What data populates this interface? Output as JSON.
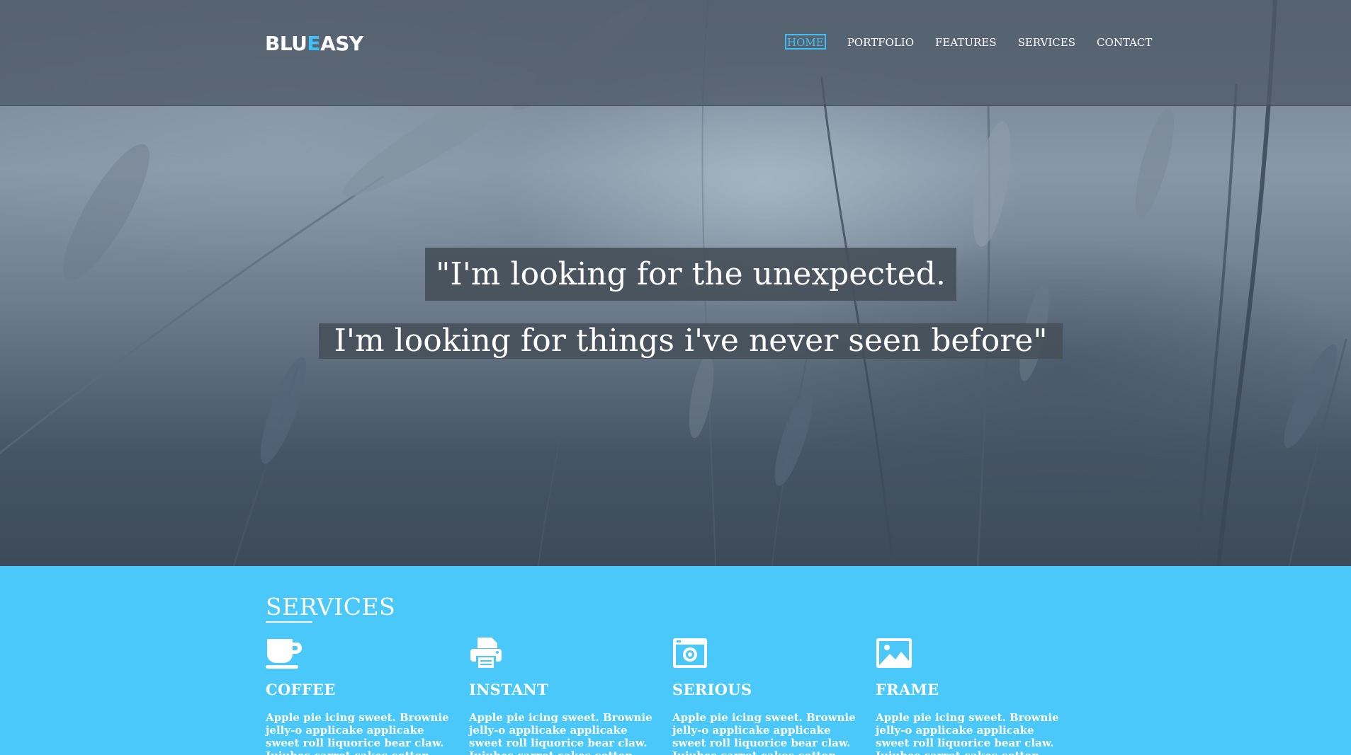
{
  "brand": {
    "logo_part1": "BLU",
    "logo_accent": "E",
    "logo_part2": "ASY"
  },
  "nav": {
    "items": [
      {
        "label": "HOME",
        "active": true
      },
      {
        "label": "PORTFOLIO",
        "active": false
      },
      {
        "label": "FEATURES",
        "active": false
      },
      {
        "label": "SERVICES",
        "active": false
      },
      {
        "label": "CONTACT",
        "active": false
      }
    ]
  },
  "hero": {
    "quote_line1": "\"I'm looking for the unexpected.",
    "quote_line2": "I'm looking for things i've never seen before\""
  },
  "services": {
    "title": "SERVICES",
    "items": [
      {
        "title": "COFFEE",
        "icon": "coffee-cup-icon",
        "text": "Apple pie icing sweet. Brownie jelly-o applicake applicake sweet roll liquorice bear claw. Jujubes carrot cakes cotton candy sweet"
      },
      {
        "title": "INSTANT",
        "icon": "printer-icon",
        "text": "Apple pie icing sweet. Brownie jelly-o applicake applicake sweet roll liquorice bear claw. Jujubes carrot cakes cotton candy sweet"
      },
      {
        "title": "SERIOUS",
        "icon": "camera-icon",
        "text": "Apple pie icing sweet. Brownie jelly-o applicake applicake sweet roll liquorice bear claw. Jujubes carrot cakes cotton candy sweet"
      },
      {
        "title": "FRAME",
        "icon": "image-icon",
        "text": "Apple pie icing sweet. Brownie jelly-o applicake applicake sweet roll liquorice bear claw. Jujubes carrot cakes cotton candy sweet"
      }
    ]
  },
  "colors": {
    "accent": "#3ec0f5",
    "services_bg": "#4ac8fa",
    "navbar_bg": "#4e5a66"
  }
}
